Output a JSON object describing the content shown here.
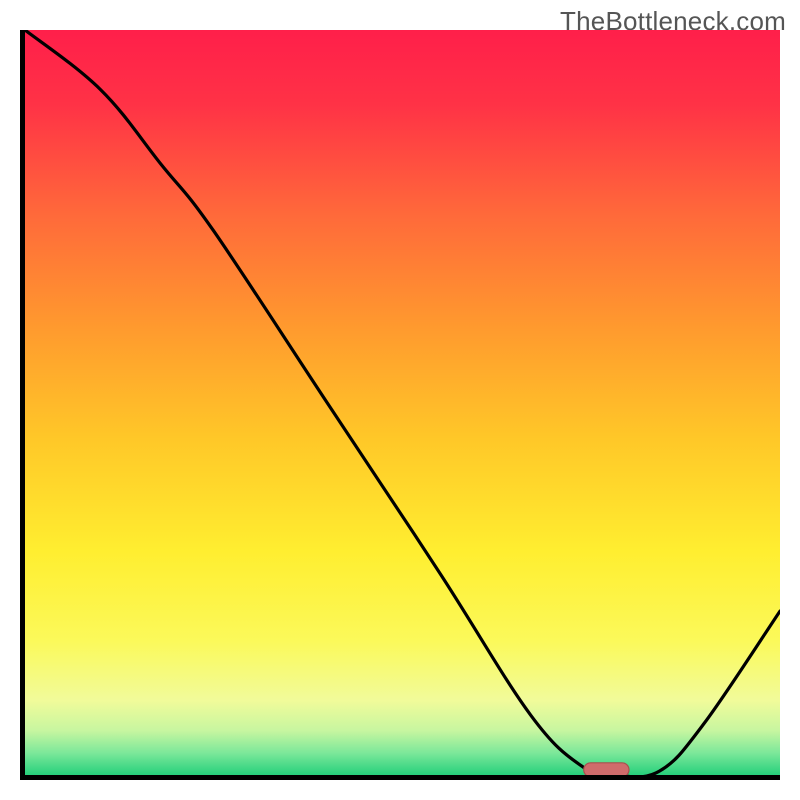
{
  "watermark": "TheBottleneck.com",
  "chart_data": {
    "type": "line",
    "title": "",
    "xlabel": "",
    "ylabel": "",
    "xlim": [
      0,
      100
    ],
    "ylim": [
      0,
      100
    ],
    "x": [
      0,
      10,
      18,
      25,
      40,
      55,
      67,
      74,
      78,
      84,
      90,
      100
    ],
    "values": [
      100,
      92,
      82,
      73,
      50,
      27,
      8,
      1,
      0,
      0.5,
      7,
      22
    ],
    "marker": {
      "x_start": 74,
      "x_end": 80,
      "y": 0.7
    },
    "gradient_stops": [
      {
        "offset": 0.0,
        "color": "#ff1f4a"
      },
      {
        "offset": 0.1,
        "color": "#ff3246"
      },
      {
        "offset": 0.25,
        "color": "#ff6a3a"
      },
      {
        "offset": 0.4,
        "color": "#ff9a2e"
      },
      {
        "offset": 0.55,
        "color": "#ffc828"
      },
      {
        "offset": 0.7,
        "color": "#ffee30"
      },
      {
        "offset": 0.82,
        "color": "#fbf95a"
      },
      {
        "offset": 0.9,
        "color": "#f1fb9a"
      },
      {
        "offset": 0.94,
        "color": "#c8f6a0"
      },
      {
        "offset": 0.97,
        "color": "#7de89a"
      },
      {
        "offset": 1.0,
        "color": "#26d07c"
      }
    ],
    "colors": {
      "curve": "#000000",
      "marker_fill": "#cf6b6b",
      "marker_stroke": "#a94e4e",
      "axes": "#000000"
    }
  }
}
